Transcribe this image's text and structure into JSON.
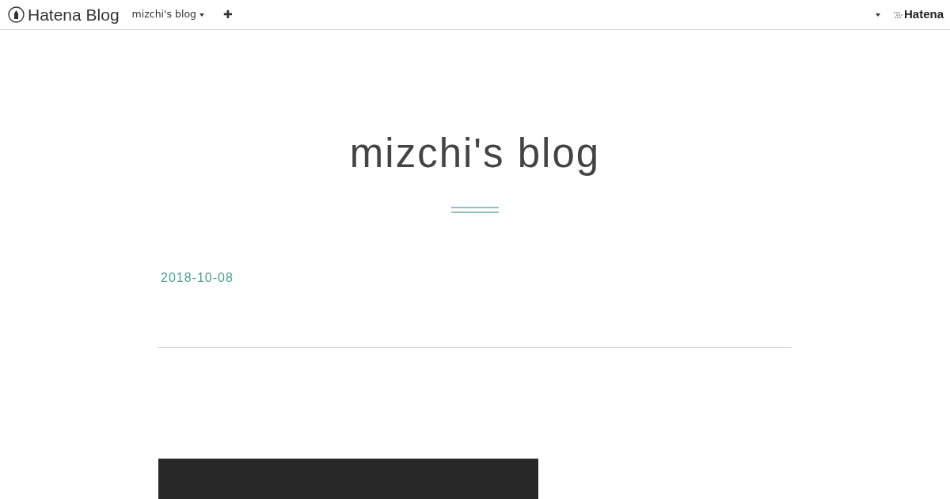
{
  "topbar": {
    "logo": "Hatena Blog",
    "blog_menu": "mizchi's blog",
    "add_button": "✚",
    "brand": "Hatena"
  },
  "blog": {
    "title": "mizchi's blog"
  },
  "entry": {
    "date": "2018-10-08"
  }
}
